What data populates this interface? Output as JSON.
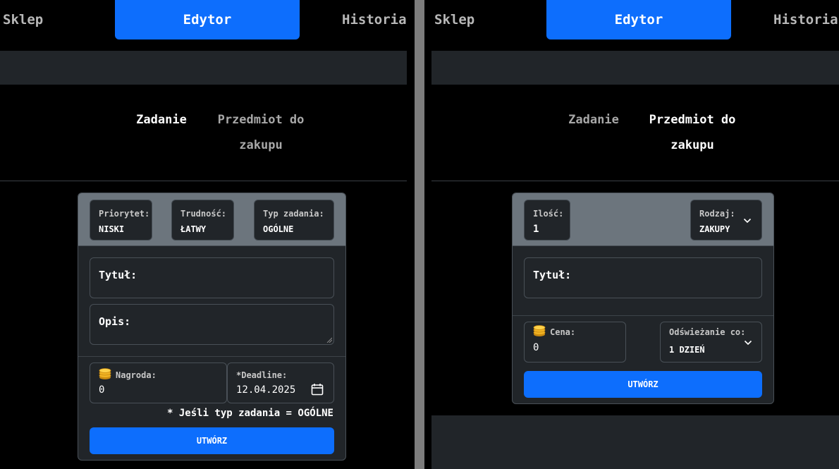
{
  "nav": {
    "shop": "Sklep",
    "editor": "Edytor",
    "history": "Historia"
  },
  "tabs": {
    "task": "Zadanie",
    "item_line1": "Przedmiot do",
    "item_line2": "zakupu"
  },
  "task_form": {
    "priority": {
      "label": "Priorytet:",
      "value": "NISKI"
    },
    "difficulty": {
      "label": "Trudność:",
      "value": "ŁATWY"
    },
    "task_type": {
      "label": "Typ zadania:",
      "value": "OGÓLNE"
    },
    "title_label": "Tytuł:",
    "description_label": "Opis:",
    "reward": {
      "label": "Nagroda:",
      "value": "0"
    },
    "deadline": {
      "label": "*Deadline:",
      "value": "12.04.2025"
    },
    "footnote": "* Jeśli typ zadania = OGÓLNE",
    "create_button": "UTWÓRZ"
  },
  "item_form": {
    "quantity": {
      "label": "Ilość:",
      "value": "1"
    },
    "kind": {
      "label": "Rodzaj:",
      "value": "ZAKUPY"
    },
    "title_label": "Tytuł:",
    "price": {
      "label": "Cena:",
      "value": "0"
    },
    "refresh": {
      "label": "Odświeżanie co:",
      "value": "1 DZIEŃ"
    },
    "create_button": "UTWÓRZ"
  },
  "icons": {
    "coin": "coin-stack-icon",
    "calendar": "calendar-icon",
    "chevron": "chevron-down-icon"
  },
  "colors": {
    "accent": "#0d6efd",
    "card_bg": "#212529",
    "card_head_bg": "#6c757d",
    "page_bg": "#000000",
    "coin": "#f0b323"
  }
}
